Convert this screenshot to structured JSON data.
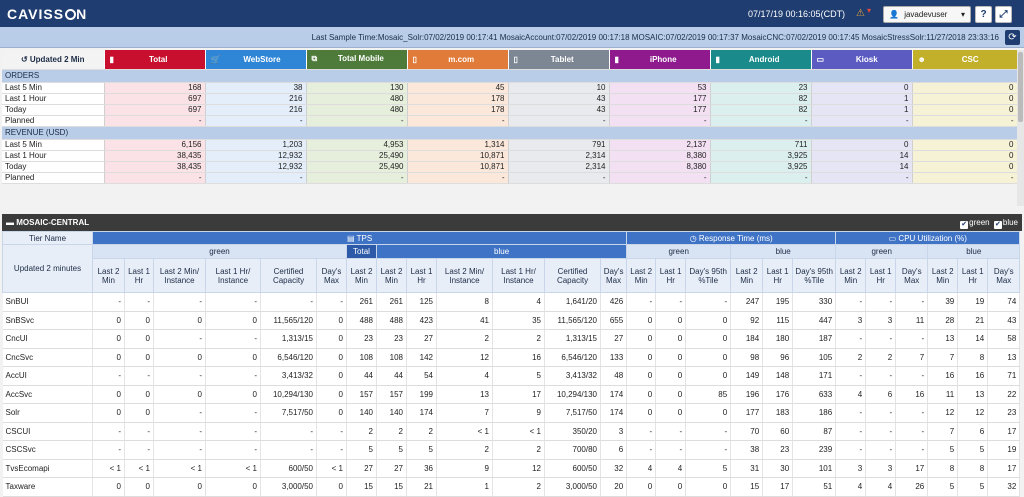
{
  "app": {
    "logo_prefix": "CAVISS",
    "logo_suffix": "N",
    "datetime": "07/17/19 00:16:05(CDT)",
    "user": "javadevuser",
    "help_label": "?",
    "expand_label": "⤢"
  },
  "info": {
    "last_sample": "Last Sample Time:Mosaic_Solr:07/02/2019 00:17:41 MosaicAccount:07/02/2019 00:17:18 MOSAIC:07/02/2019 00:17:37 MosaicCNC:07/02/2019 00:17:45 MosaicStressSolr:11/27/2018 23:33:16"
  },
  "channels": {
    "update_label": "Updated 2 Min",
    "items": [
      {
        "label": "Total",
        "header_color": "#c8102e",
        "cell_color": "#fbe2e6",
        "icon": "▮"
      },
      {
        "label": "WebStore",
        "header_color": "#2f86d6",
        "cell_color": "#e3eefa",
        "icon": "🛒"
      },
      {
        "label": "Total Mobile",
        "header_color": "#4e7a3a",
        "cell_color": "#e6efdc",
        "icon": "⧉"
      },
      {
        "label": "m.com",
        "header_color": "#e07b39",
        "cell_color": "#fbe8db",
        "icon": "▯"
      },
      {
        "label": "Tablet",
        "header_color": "#7d8794",
        "cell_color": "#e8eaed",
        "icon": "▯"
      },
      {
        "label": "iPhone",
        "header_color": "#8e1a8e",
        "cell_color": "#f3e1f3",
        "icon": "▮"
      },
      {
        "label": "Android",
        "header_color": "#1a8a8a",
        "cell_color": "#dcefef",
        "icon": "▮"
      },
      {
        "label": "Kiosk",
        "header_color": "#5b5bc2",
        "cell_color": "#e5e5f6",
        "icon": "▭"
      },
      {
        "label": "CSC",
        "header_color": "#c2b02a",
        "cell_color": "#f6f2d6",
        "icon": "☻"
      }
    ]
  },
  "orders": {
    "title": "ORDERS",
    "rows": [
      {
        "label": "Last 5 Min",
        "values": [
          "168",
          "38",
          "130",
          "45",
          "10",
          "53",
          "23",
          "0",
          "0"
        ]
      },
      {
        "label": "Last 1 Hour",
        "values": [
          "697",
          "216",
          "480",
          "178",
          "43",
          "177",
          "82",
          "1",
          "0"
        ]
      },
      {
        "label": "Today",
        "values": [
          "697",
          "216",
          "480",
          "178",
          "43",
          "177",
          "82",
          "1",
          "0"
        ]
      },
      {
        "label": "Planned",
        "values": [
          "-",
          "-",
          "-",
          "-",
          "-",
          "-",
          "-",
          "-",
          "-"
        ]
      }
    ]
  },
  "revenue": {
    "title": "REVENUE (USD)",
    "rows": [
      {
        "label": "Last 5 Min",
        "values": [
          "6,156",
          "1,203",
          "4,953",
          "1,314",
          "791",
          "2,137",
          "711",
          "0",
          "0"
        ]
      },
      {
        "label": "Last 1 Hour",
        "values": [
          "38,435",
          "12,932",
          "25,490",
          "10,871",
          "2,314",
          "8,380",
          "3,925",
          "14",
          "0"
        ]
      },
      {
        "label": "Today",
        "values": [
          "38,435",
          "12,932",
          "25,490",
          "10,871",
          "2,314",
          "8,380",
          "3,925",
          "14",
          "0"
        ]
      },
      {
        "label": "Planned",
        "values": [
          "-",
          "-",
          "-",
          "-",
          "-",
          "-",
          "-",
          "-",
          "-"
        ]
      }
    ]
  },
  "mosaic": {
    "title": "MOSAIC-CENTRAL",
    "legend_green": "green",
    "legend_blue": "blue"
  },
  "grid": {
    "tier_name": "Tier Name",
    "updated": "Updated 2 minutes",
    "tps": "TPS",
    "rt": "Response Time (ms)",
    "cpu": "CPU Utilization (%)",
    "green": "green",
    "blue": "blue",
    "total": "Total",
    "tps_cols_green": [
      "Last 2 Min",
      "Last 1 Hr",
      "Last 2 Min/ Instance",
      "Last 1 Hr/ Instance",
      "Certified Capacity",
      "Day's Max"
    ],
    "tps_total_col": "Last 2 Min",
    "tps_cols_blue": [
      "Last 2 Min",
      "Last 1 Hr",
      "Last 2 Min/ Instance",
      "Last 1 Hr/ Instance",
      "Certified Capacity",
      "Day's Max"
    ],
    "rt_cols": [
      "Last 2 Min",
      "Last 1 Hr",
      "Day's 95th %Tile"
    ],
    "cpu_cols": [
      "Last 2 Min",
      "Last 1 Hr",
      "Day's Max"
    ],
    "rows": [
      {
        "name": "SnBUI",
        "v": [
          "-",
          "-",
          "-",
          "-",
          "-",
          "-",
          "261",
          "261",
          "125",
          "8",
          "4",
          "1,641/20",
          "426",
          "-",
          "-",
          "-",
          "247",
          "195",
          "330",
          "-",
          "-",
          "-",
          "39",
          "19",
          "74"
        ]
      },
      {
        "name": "SnBSvc",
        "v": [
          "0",
          "0",
          "0",
          "0",
          "11,565/120",
          "0",
          "488",
          "488",
          "423",
          "41",
          "35",
          "11,565/120",
          "655",
          "0",
          "0",
          "0",
          "92",
          "115",
          "447",
          "3",
          "3",
          "11",
          "28",
          "21",
          "43"
        ]
      },
      {
        "name": "CncUI",
        "v": [
          "0",
          "0",
          "-",
          "-",
          "1,313/15",
          "0",
          "23",
          "23",
          "27",
          "2",
          "2",
          "1,313/15",
          "27",
          "0",
          "0",
          "0",
          "184",
          "180",
          "187",
          "-",
          "-",
          "-",
          "13",
          "14",
          "58"
        ]
      },
      {
        "name": "CncSvc",
        "v": [
          "0",
          "0",
          "0",
          "0",
          "6,546/120",
          "0",
          "108",
          "108",
          "142",
          "12",
          "16",
          "6,546/120",
          "133",
          "0",
          "0",
          "0",
          "98",
          "96",
          "105",
          "2",
          "2",
          "7",
          "7",
          "8",
          "13"
        ]
      },
      {
        "name": "AccUI",
        "v": [
          "-",
          "-",
          "-",
          "-",
          "3,413/32",
          "0",
          "44",
          "44",
          "54",
          "4",
          "5",
          "3,413/32",
          "48",
          "0",
          "0",
          "0",
          "149",
          "148",
          "171",
          "-",
          "-",
          "-",
          "16",
          "16",
          "71"
        ]
      },
      {
        "name": "AccSvc",
        "v": [
          "0",
          "0",
          "0",
          "0",
          "10,294/130",
          "0",
          "157",
          "157",
          "199",
          "13",
          "17",
          "10,294/130",
          "174",
          "0",
          "0",
          "85",
          "196",
          "176",
          "633",
          "4",
          "6",
          "16",
          "11",
          "13",
          "22"
        ]
      },
      {
        "name": "Solr",
        "v": [
          "0",
          "0",
          "-",
          "-",
          "7,517/50",
          "0",
          "140",
          "140",
          "174",
          "7",
          "9",
          "7,517/50",
          "174",
          "0",
          "0",
          "0",
          "177",
          "183",
          "186",
          "-",
          "-",
          "-",
          "12",
          "12",
          "23"
        ]
      },
      {
        "name": "CSCUI",
        "v": [
          "-",
          "-",
          "-",
          "-",
          "-",
          "-",
          "2",
          "2",
          "2",
          "< 1",
          "< 1",
          "350/20",
          "3",
          "-",
          "-",
          "-",
          "70",
          "60",
          "87",
          "-",
          "-",
          "-",
          "7",
          "6",
          "17"
        ]
      },
      {
        "name": "CSCSvc",
        "v": [
          "-",
          "-",
          "-",
          "-",
          "-",
          "-",
          "5",
          "5",
          "5",
          "2",
          "2",
          "700/80",
          "6",
          "-",
          "-",
          "-",
          "38",
          "23",
          "239",
          "-",
          "-",
          "-",
          "5",
          "5",
          "19"
        ]
      },
      {
        "name": "TvsEcomapi",
        "v": [
          "< 1",
          "< 1",
          "< 1",
          "< 1",
          "600/50",
          "< 1",
          "27",
          "27",
          "36",
          "9",
          "12",
          "600/50",
          "32",
          "4",
          "4",
          "5",
          "31",
          "30",
          "101",
          "3",
          "3",
          "17",
          "8",
          "8",
          "17"
        ]
      },
      {
        "name": "Taxware",
        "v": [
          "0",
          "0",
          "0",
          "0",
          "3,000/50",
          "0",
          "15",
          "15",
          "21",
          "1",
          "2",
          "3,000/50",
          "20",
          "0",
          "0",
          "0",
          "15",
          "17",
          "51",
          "4",
          "4",
          "26",
          "5",
          "5",
          "32"
        ]
      }
    ]
  }
}
